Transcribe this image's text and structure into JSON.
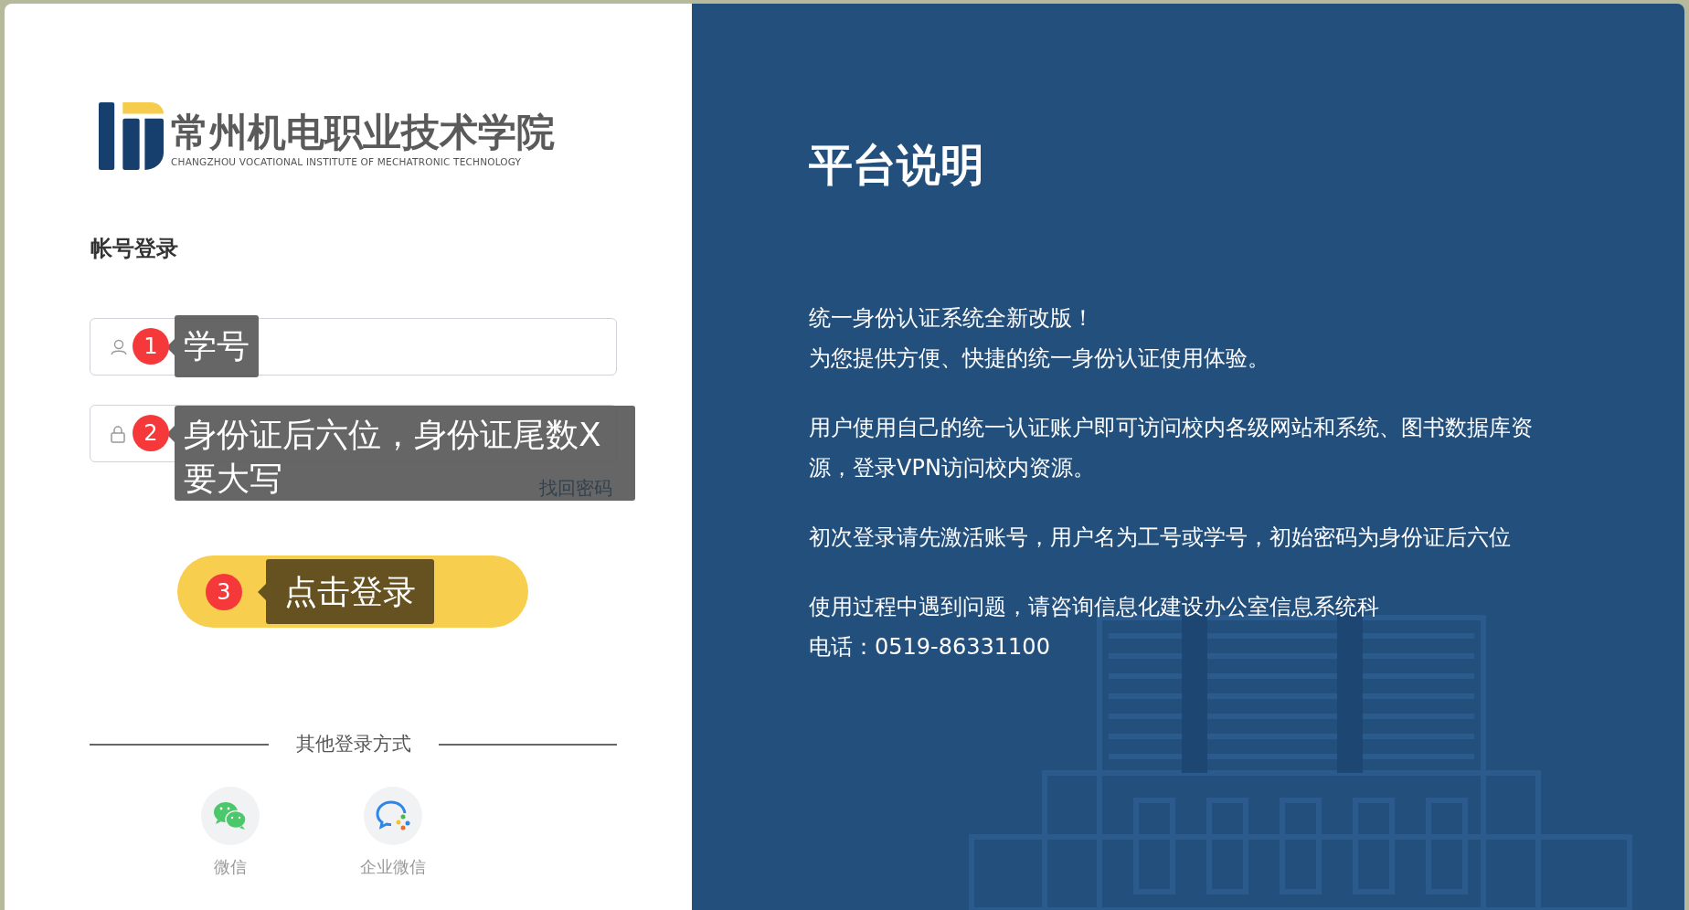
{
  "logo": {
    "name": "常州机电职业技术学院",
    "subtitle": "CHANGZHOU VOCATIONAL INSTITUTE OF MECHATRONIC TECHNOLOGY"
  },
  "login_title": "帐号登录",
  "fields": [
    {
      "kind": "user",
      "step": "1",
      "hint": "学号"
    },
    {
      "kind": "password",
      "step": "2",
      "hint": "身份证后六位，身份证尾数X要大写"
    }
  ],
  "forgot_link": "找回密码",
  "login_button": {
    "step": "3",
    "hint": "点击登录"
  },
  "other_login": {
    "title": "其他登录方式",
    "options": [
      {
        "kind": "wechat",
        "label": "微信"
      },
      {
        "kind": "wecom",
        "label": "企业微信"
      }
    ]
  },
  "info": {
    "title": "平台说明",
    "paragraphs": [
      [
        "统一身份认证系统全新改版！",
        "为您提供方便、快捷的统一身份认证使用体验。"
      ],
      [
        "用户使用自己的统一认证账户即可访问校内各级网站和系统、图书数据库资源，登录VPN访问校内资源。"
      ],
      [
        "初次登录请先激活账号，用户名为工号或学号，初始密码为身份证后六位"
      ],
      [
        "使用过程中遇到问题，请咨询信息化建设办公室信息系统科",
        "电话：0519-86331100"
      ]
    ]
  }
}
